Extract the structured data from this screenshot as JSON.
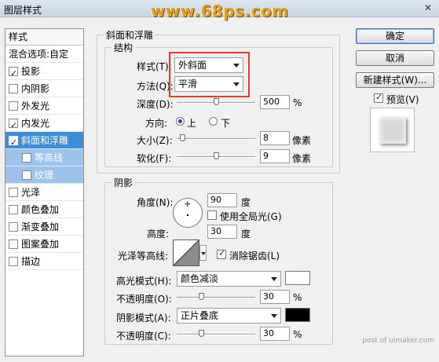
{
  "window": {
    "title": "图层样式",
    "watermark": "www.68ps.com",
    "close": "✕"
  },
  "stylelist": {
    "header": "样式",
    "items": [
      {
        "label": "混合选项:自定",
        "checkbox": null,
        "state": "normal"
      },
      {
        "label": "投影",
        "checkbox": true,
        "state": "normal"
      },
      {
        "label": "内阴影",
        "checkbox": false,
        "state": "normal"
      },
      {
        "label": "外发光",
        "checkbox": false,
        "state": "normal"
      },
      {
        "label": "内发光",
        "checkbox": true,
        "state": "normal"
      },
      {
        "label": "斜面和浮雕",
        "checkbox": true,
        "state": "selected"
      },
      {
        "label": "等高线",
        "checkbox": false,
        "state": "sub"
      },
      {
        "label": "纹理",
        "checkbox": false,
        "state": "sub"
      },
      {
        "label": "光泽",
        "checkbox": false,
        "state": "normal"
      },
      {
        "label": "颜色叠加",
        "checkbox": false,
        "state": "normal"
      },
      {
        "label": "渐变叠加",
        "checkbox": false,
        "state": "normal"
      },
      {
        "label": "图案叠加",
        "checkbox": false,
        "state": "normal"
      },
      {
        "label": "描边",
        "checkbox": false,
        "state": "normal"
      }
    ]
  },
  "bevel": {
    "group_title": "斜面和浮雕",
    "structure_title": "结构",
    "style_label": "样式(T):",
    "style_value": "外斜面",
    "technique_label": "方法(Q):",
    "technique_value": "平滑",
    "depth_label": "深度(D):",
    "depth_value": "500",
    "depth_pct": 0.5,
    "percent": "%",
    "direction_label": "方向:",
    "direction_up": "上",
    "direction_down": "下",
    "size_label": "大小(Z):",
    "size_value": "8",
    "size_pct": 0.04,
    "pixels": "像素",
    "soften_label": "软化(F):",
    "soften_value": "9",
    "soften_pct": 0.5
  },
  "shading": {
    "title": "阴影",
    "angle_label": "角度(N):",
    "angle_value": "90",
    "degree": "度",
    "global_light_label": "使用全局光(G)",
    "global_light_checked": false,
    "altitude_label": "高度:",
    "altitude_value": "30",
    "gloss_contour_label": "光泽等高线:",
    "antialias_label": "消除锯齿(L)",
    "antialias_checked": true,
    "highlight_mode_label": "高光模式(H):",
    "highlight_mode_value": "颜色减淡",
    "highlight_color": "#ffffff",
    "highlight_opacity_label": "不透明度(O):",
    "highlight_opacity_value": "30",
    "highlight_opacity_pct": 0.3,
    "shadow_mode_label": "阴影模式(A):",
    "shadow_mode_value": "正片叠底",
    "shadow_color": "#000000",
    "shadow_opacity_label": "不透明度(C):",
    "shadow_opacity_value": "30",
    "shadow_opacity_pct": 0.3,
    "percent": "%"
  },
  "buttons": {
    "ok": "确定",
    "cancel": "取消",
    "new_style": "新建样式(W)...",
    "preview_label": "预览(V)",
    "preview_checked": true
  },
  "footer": "post of uimaker.com",
  "colors": {
    "selection": "#3c8cdc",
    "sub_selection": "#9cc3ec",
    "highlight_box": "#e53b2b",
    "watermark": "#e0a22a"
  }
}
